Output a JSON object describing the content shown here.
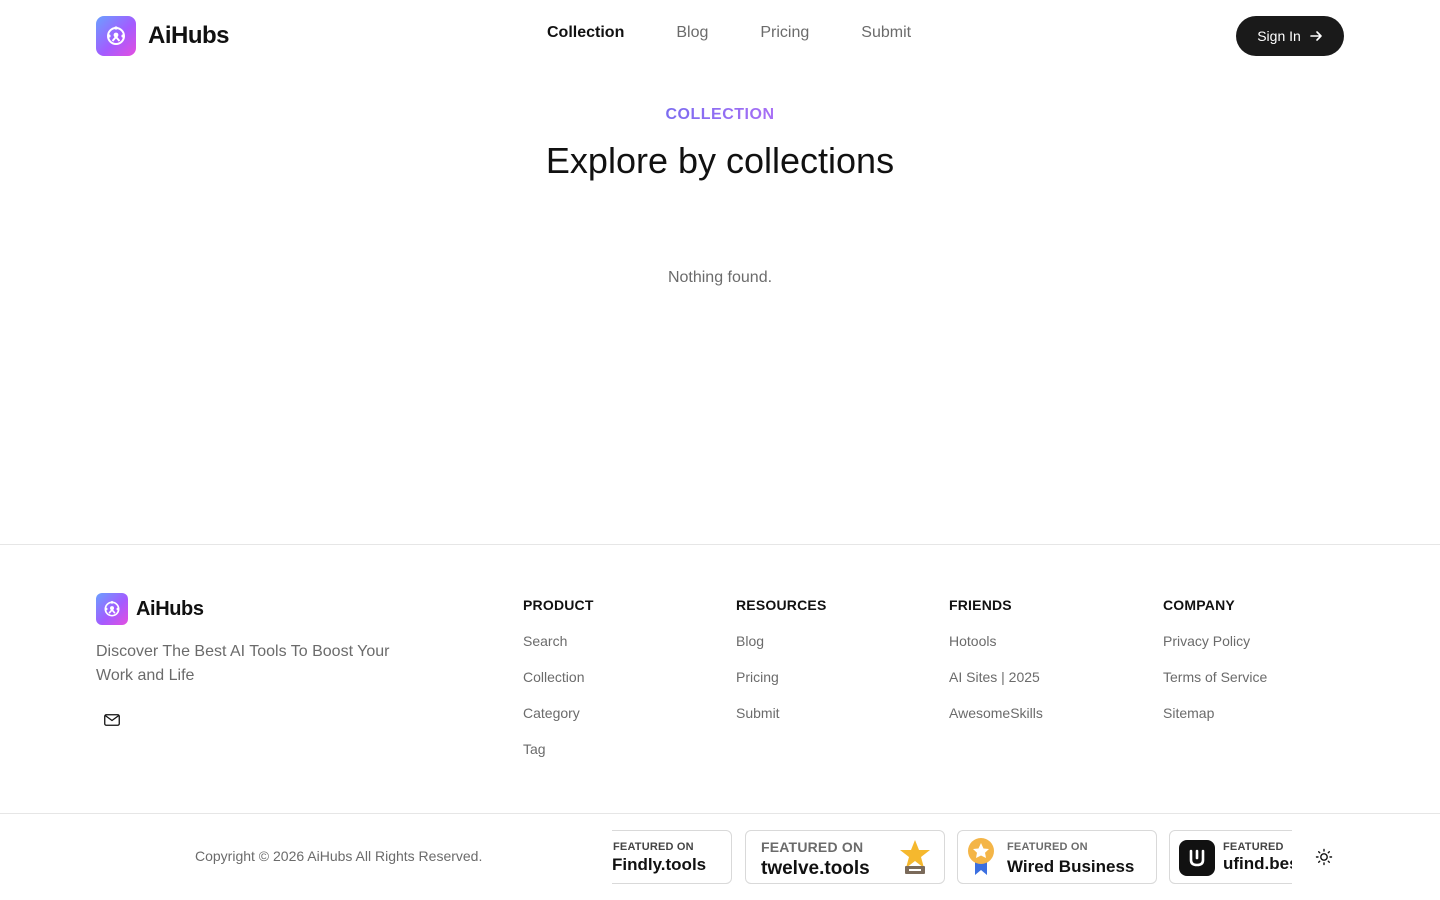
{
  "header": {
    "brand": "AiHubs",
    "nav": [
      {
        "label": "Collection",
        "active": true
      },
      {
        "label": "Blog",
        "active": false
      },
      {
        "label": "Pricing",
        "active": false
      },
      {
        "label": "Submit",
        "active": false
      }
    ],
    "signin_label": "Sign In"
  },
  "hero": {
    "eyebrow": "COLLECTION",
    "title": "Explore by collections",
    "empty_message": "Nothing found."
  },
  "footer": {
    "brand": "AiHubs",
    "tagline": "Discover The Best AI Tools To Boost Your Work and Life",
    "columns": [
      {
        "heading": "PRODUCT",
        "links": [
          "Search",
          "Collection",
          "Category",
          "Tag"
        ]
      },
      {
        "heading": "RESOURCES",
        "links": [
          "Blog",
          "Pricing",
          "Submit"
        ]
      },
      {
        "heading": "FRIENDS",
        "links": [
          "Hotools",
          "AI Sites | 2025",
          "AwesomeSkills"
        ]
      },
      {
        "heading": "COMPANY",
        "links": [
          "Privacy Policy",
          "Terms of Service",
          "Sitemap"
        ]
      }
    ],
    "copyright": "Copyright © 2026 AiHubs All Rights Reserved.",
    "badges": [
      {
        "small": "FEATURED ON",
        "big": "Findly.tools"
      },
      {
        "small": "FEATURED ON",
        "big": "twelve.tools"
      },
      {
        "small": "FEATURED ON",
        "big": "Wired Business"
      },
      {
        "small": "FEATURED",
        "big": "ufind.best"
      }
    ]
  },
  "icons": {
    "brand_logo": "robot-icon",
    "signin_arrow": "arrow-right-icon",
    "email": "mail-icon",
    "theme": "sun-icon"
  },
  "colors": {
    "accent_gradient_start": "#7b6cf0",
    "accent_gradient_end": "#a86ff5",
    "button_dark": "#1a1a1a"
  }
}
